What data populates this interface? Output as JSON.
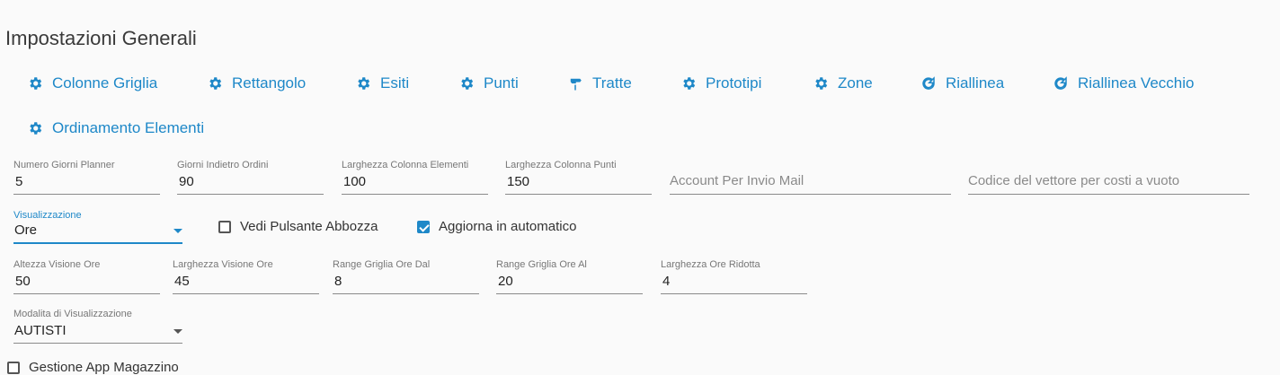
{
  "page_title": "Impostazioni Generali",
  "toolbar": {
    "colonne_griglia": "Colonne Griglia",
    "rettangolo": "Rettangolo",
    "esiti": "Esiti",
    "punti": "Punti",
    "tratte": "Tratte",
    "prototipi": "Prototipi",
    "zone": "Zone",
    "riallinea": "Riallinea",
    "riallinea_vecchio": "Riallinea Vecchio",
    "ordinamento_elementi": "Ordinamento Elementi"
  },
  "fields_row1": {
    "numero_giorni_planner": {
      "label": "Numero Giorni Planner",
      "value": "5"
    },
    "giorni_indietro_ordini": {
      "label": "Giorni Indietro Ordini",
      "value": "90"
    },
    "larghezza_colonna_elementi": {
      "label": "Larghezza Colonna Elementi",
      "value": "100"
    },
    "larghezza_colonna_punti": {
      "label": "Larghezza Colonna Punti",
      "value": "150"
    },
    "account_invio_mail": {
      "placeholder": "Account Per Invio Mail"
    },
    "codice_vettore": {
      "placeholder": "Codice del vettore per costi a vuoto"
    }
  },
  "visualizzazione": {
    "label": "Visualizzazione",
    "value": "Ore"
  },
  "checkboxes": {
    "vedi_pulsante_abbozza": {
      "label": "Vedi Pulsante Abbozza",
      "checked": false
    },
    "aggiorna_automatico": {
      "label": "Aggiorna in automatico",
      "checked": true
    },
    "gestione_app_magazzino": {
      "label": "Gestione App Magazzino",
      "checked": false
    }
  },
  "fields_row3": {
    "altezza_visione_ore": {
      "label": "Altezza Visione Ore",
      "value": "50"
    },
    "larghezza_visione_ore": {
      "label": "Larghezza Visione Ore",
      "value": "45"
    },
    "range_griglia_dal": {
      "label": "Range Griglia Ore Dal",
      "value": "8"
    },
    "range_griglia_al": {
      "label": "Range Griglia Ore Al",
      "value": "20"
    },
    "larghezza_ore_ridotta": {
      "label": "Larghezza Ore Ridotta",
      "value": "4"
    }
  },
  "modalita": {
    "label": "Modalita di Visualizzazione",
    "value": "AUTISTI"
  },
  "colors": {
    "accent": "#1e88c8",
    "background": "#fafafa"
  }
}
